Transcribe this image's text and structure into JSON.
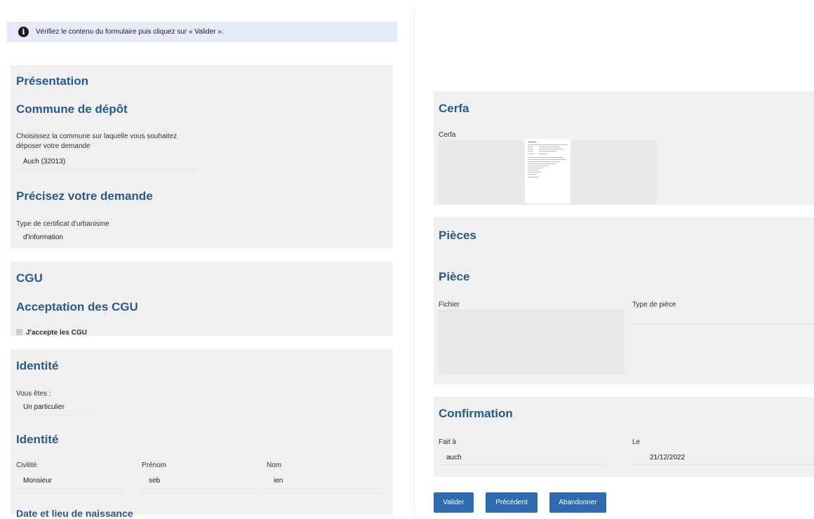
{
  "notice": {
    "text": "Vérifiez le contenu du formulaire puis cliquez sur « Valider »."
  },
  "presentation": {
    "title": "Présentation",
    "commune": {
      "title": "Commune de dépôt",
      "label_line1": "Choisissez la commune sur laquelle vous souhaitez",
      "label_line2": "déposer votre demande",
      "value": "Auch (32013)"
    },
    "demande": {
      "title": "Précisez votre demande",
      "label": "Type de certificat d'urbanisme",
      "value": "d'information"
    }
  },
  "cgu": {
    "title": "CGU",
    "subtitle": "Acceptation des CGU",
    "checkbox_label": "J'accepte les CGU"
  },
  "identite": {
    "title": "Identité",
    "vous_etes_label": "Vous êtes :",
    "vous_etes_value": "Un particulier",
    "sub_title": "Identité",
    "civilite_label": "Civilité",
    "civilite_value": "Monsieur",
    "prenom_label": "Prénom",
    "prenom_value": "seb",
    "nom_label": "Nom",
    "nom_value": "ien",
    "naissance_title": "Date et lieu de naissance"
  },
  "cerfa": {
    "title": "Cerfa",
    "label": "Cerfa"
  },
  "pieces": {
    "title": "Pièces",
    "subtitle": "Pièce",
    "fichier_label": "Fichier",
    "type_label": "Type de pièce"
  },
  "confirmation": {
    "title": "Confirmation",
    "fait_a_label": "Fait à",
    "fait_a_value": "auch",
    "le_label": "Le",
    "le_value": "21/12/2022"
  },
  "buttons": {
    "valider": "Valider",
    "precedent": "Précédent",
    "abandonner": "Abandonner"
  }
}
